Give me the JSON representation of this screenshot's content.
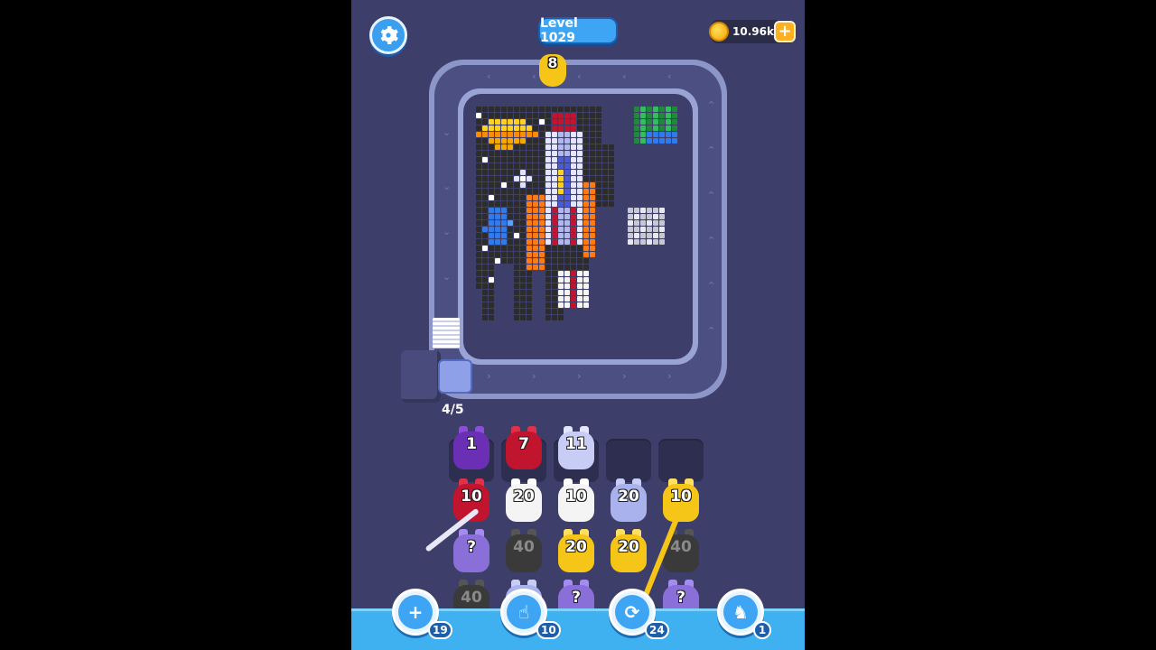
{
  "header": {
    "level_label": "Level 1029",
    "coins": "10.96k",
    "coins_add_symbol": "+",
    "settings_icon": "gear-icon"
  },
  "conveyor": {
    "capacity_label": "4/5",
    "runner_count": "8",
    "runner_color": "#f5c518"
  },
  "queue_slots": [
    {
      "count": "1",
      "color": "#6a2fb5",
      "ear": "#8a4fd5"
    },
    {
      "count": "7",
      "color": "#c0142f",
      "ear": "#e0304a"
    },
    {
      "count": "11",
      "color": "#c8cdf5",
      "ear": "#e4e7ff"
    },
    {
      "count": "",
      "color": "",
      "ear": ""
    },
    {
      "count": "",
      "color": "",
      "ear": ""
    }
  ],
  "pig_grid": [
    [
      {
        "count": "10",
        "color": "#c0142f",
        "ear": "#e0304a",
        "dim": false
      },
      {
        "count": "20",
        "color": "#f4f4f4",
        "ear": "#ffffff",
        "dim": false
      },
      {
        "count": "10",
        "color": "#f4f4f4",
        "ear": "#ffffff",
        "dim": false
      },
      {
        "count": "20",
        "color": "#aab2ee",
        "ear": "#c8cdf5",
        "dim": false
      },
      {
        "count": "10",
        "color": "#f5c518",
        "ear": "#ffe060",
        "dim": false
      }
    ],
    [
      {
        "count": "?",
        "color": "#8a6fd8",
        "ear": "#a48cf0",
        "dim": false
      },
      {
        "count": "40",
        "color": "#3a3a3a",
        "ear": "#555555",
        "dim": true
      },
      {
        "count": "20",
        "color": "#f5c518",
        "ear": "#ffe060",
        "dim": false
      },
      {
        "count": "20",
        "color": "#f5c518",
        "ear": "#ffe060",
        "dim": false
      },
      {
        "count": "40",
        "color": "#3a3a3a",
        "ear": "#555555",
        "dim": true
      }
    ],
    [
      {
        "count": "40",
        "color": "#3a3a3a",
        "ear": "#555555",
        "dim": true
      },
      {
        "count": "",
        "color": "#aab2ee",
        "ear": "#c8cdf5",
        "dim": false
      },
      {
        "count": "?",
        "color": "#8a6fd8",
        "ear": "#a48cf0",
        "dim": false
      },
      {
        "count": "",
        "color": "",
        "ear": "",
        "dim": false
      },
      {
        "count": "?",
        "color": "#8a6fd8",
        "ear": "#a48cf0",
        "dim": false
      }
    ]
  ],
  "boosters": [
    {
      "name": "add-slot",
      "icon": "add-box-icon",
      "glyph": "+",
      "count": "19"
    },
    {
      "name": "tap",
      "icon": "hand-pointer-icon",
      "glyph": "☝",
      "count": "10"
    },
    {
      "name": "shuffle",
      "icon": "shuffle-icon",
      "glyph": "⟳",
      "count": "24"
    },
    {
      "name": "magnet",
      "icon": "pig-icon",
      "glyph": "♞",
      "count": "1"
    }
  ],
  "colors": {
    "background": "#3d3e6a",
    "track": "#8d96c9",
    "accent_blue": "#3ea4f4"
  }
}
